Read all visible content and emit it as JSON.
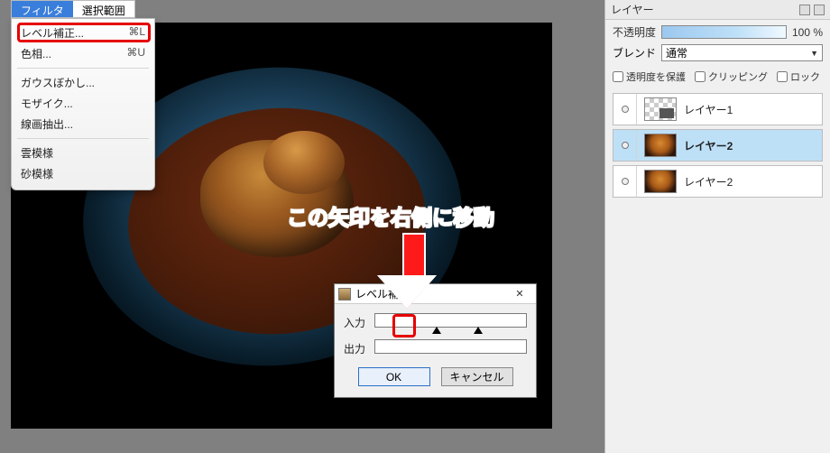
{
  "menubar": {
    "filter_label": "フィルタ",
    "selection_label": "選択範囲"
  },
  "dropdown": {
    "items": [
      {
        "label": "レベル補正...",
        "shortcut": "⌘L"
      },
      {
        "label": "色相...",
        "shortcut": "⌘U"
      },
      {
        "label": "ガウスぼかし...",
        "shortcut": ""
      },
      {
        "label": "モザイク...",
        "shortcut": ""
      },
      {
        "label": "線画抽出...",
        "shortcut": ""
      },
      {
        "label": "雲模様",
        "shortcut": ""
      },
      {
        "label": "砂模様",
        "shortcut": ""
      }
    ]
  },
  "annotation": {
    "text": "この矢印を右側に移動"
  },
  "dialog": {
    "title": "レベル補正",
    "input_label": "入力",
    "output_label": "出力",
    "ok_label": "OK",
    "cancel_label": "キャンセル",
    "input_slider": {
      "handles_pct": [
        38,
        65
      ]
    },
    "output_slider": {
      "handles_pct": []
    }
  },
  "panel": {
    "title": "レイヤー",
    "opacity_label": "不透明度",
    "opacity_value": "100 %",
    "blend_label": "ブレンド",
    "blend_value": "通常",
    "checks": {
      "preserve_alpha": "透明度を保護",
      "clipping": "クリッピング",
      "lock": "ロック"
    },
    "layers": [
      {
        "name": "レイヤー1",
        "selected": false,
        "thumb": "checker"
      },
      {
        "name": "レイヤー2",
        "selected": true,
        "thumb": "soup"
      },
      {
        "name": "レイヤー2",
        "selected": false,
        "thumb": "soup"
      }
    ]
  }
}
